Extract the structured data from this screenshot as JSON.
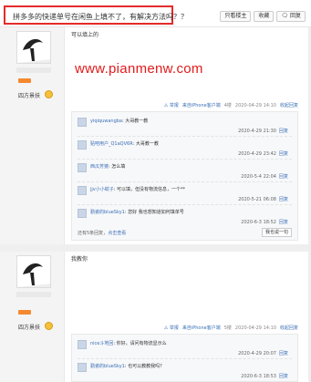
{
  "thread": {
    "title": "拼多多的快递单号在闲鱼上填不了，有解决方法吗？？",
    "buttons": [
      "只看楼主",
      "收藏",
      "回复"
    ]
  },
  "watermark": "www.pianmenw.com",
  "posts": [
    {
      "rank": "四方景扶",
      "text": "可以填上的",
      "meta": {
        "report": "举报",
        "device": "来自iPhone客户端",
        "floor": "4楼",
        "time": "2020-04-29 14:10",
        "collapse": "收起回复"
      },
      "replies": [
        {
          "user": "yiqiquwangba",
          "text": ": 大哥教一教",
          "time": "2020-4-29 21:30",
          "action": "回复"
        },
        {
          "user": "贴吧用户_Q1aQV6R",
          "text": ": 大哥教一教",
          "time": "2020-4-29 23:42",
          "action": "回复"
        },
        {
          "user": "西瓜芳婆",
          "text": ": 怎么填",
          "time": "2020-5-4 22:04",
          "action": "回复"
        },
        {
          "user": "jjv小小蚊子",
          "text": ": 可以填，但没有物流信息，一个**",
          "time": "2020-5-21 06:08",
          "action": "回复"
        },
        {
          "user": "勤瓷的blueSky1",
          "text": ": 您好 我也想知道如何填单号",
          "time": "2020-6-3 18:52",
          "action": "回复"
        }
      ],
      "more": {
        "prefix": "还有5条回复，",
        "link": "点击查看"
      },
      "say_button": "我也说一句"
    },
    {
      "rank": "四方景扶",
      "text": "我教你",
      "meta": {
        "report": "举报",
        "device": "来自iPhone客户端",
        "floor": "5楼",
        "time": "2020-04-29 14:10",
        "collapse": "收起回复"
      },
      "replies": [
        {
          "user": "nice斗地回",
          "text": ": 你好，请问有物流显示么",
          "time": "2020-4-29 20:07",
          "action": "回复"
        },
        {
          "user": "勤瓷的blueSky1",
          "text": ": 也可以教教我吗？",
          "time": "2020-6-3 18:53",
          "action": "回复"
        }
      ]
    }
  ]
}
